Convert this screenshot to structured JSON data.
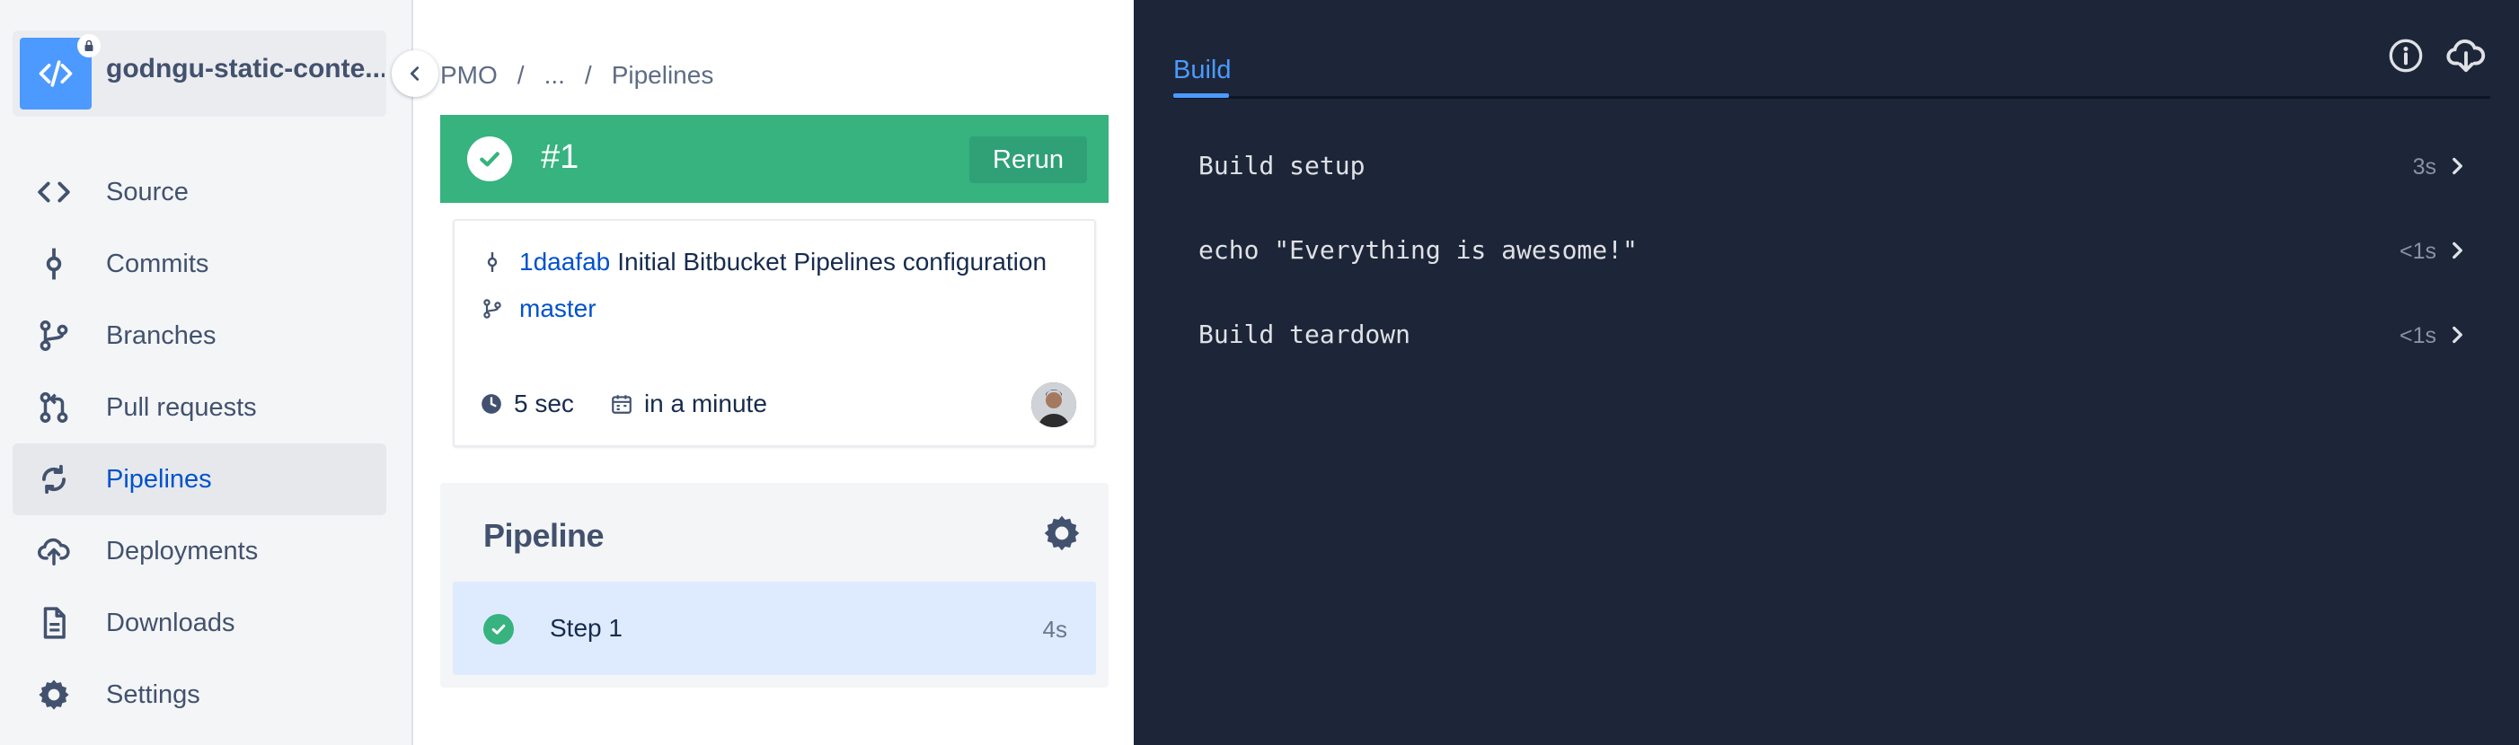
{
  "sidebar": {
    "repo_name": "godngu-static-conte...",
    "items": [
      {
        "label": "Source",
        "icon": "code-icon",
        "active": false
      },
      {
        "label": "Commits",
        "icon": "commit-icon",
        "active": false
      },
      {
        "label": "Branches",
        "icon": "branch-icon",
        "active": false
      },
      {
        "label": "Pull requests",
        "icon": "pull-request-icon",
        "active": false
      },
      {
        "label": "Pipelines",
        "icon": "pipelines-icon",
        "active": true
      },
      {
        "label": "Deployments",
        "icon": "deployments-icon",
        "active": false
      },
      {
        "label": "Downloads",
        "icon": "download-icon",
        "active": false
      },
      {
        "label": "Settings",
        "icon": "gear-icon",
        "active": false
      }
    ]
  },
  "breadcrumb": {
    "items": [
      "PMO",
      "...",
      "Pipelines"
    ],
    "separator": "/"
  },
  "run": {
    "number": "#1",
    "rerun_label": "Rerun",
    "status_color": "#36b37e"
  },
  "commit": {
    "hash": "1daafab",
    "message": "Initial Bitbucket Pipelines configuration",
    "branch": "master",
    "duration": "5 sec",
    "when": "in a minute"
  },
  "pipeline": {
    "title": "Pipeline",
    "steps": [
      {
        "label": "Step 1",
        "duration": "4s",
        "status": "success"
      }
    ]
  },
  "log": {
    "tab_label": "Build",
    "steps": [
      {
        "name": "Build setup",
        "time": "3s"
      },
      {
        "name": "echo \"Everything is awesome!\"",
        "time": "<1s"
      },
      {
        "name": "Build teardown",
        "time": "<1s"
      }
    ]
  },
  "colors": {
    "accent": "#0052cc",
    "success": "#36b37e",
    "log_background": "#1d2638"
  }
}
